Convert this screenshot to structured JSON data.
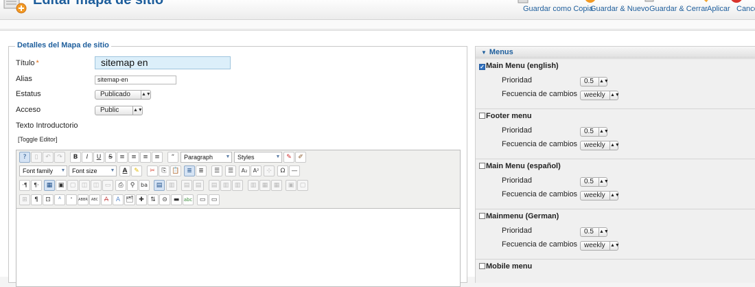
{
  "header": {
    "title": "Editar mapa de sitio",
    "toolbar": [
      {
        "label": "Guardar como Copia",
        "icon": "copy-icon",
        "color": "#dddddd"
      },
      {
        "label": "Guardar & Nuevo",
        "icon": "save-new-icon",
        "color": "#f39a24"
      },
      {
        "label": "Guardar & Cerrar",
        "icon": "save-close-icon",
        "color": "#d9d9d9"
      },
      {
        "label": "Aplicar",
        "icon": "apply-icon",
        "color": "#f0a431"
      },
      {
        "label": "Cance",
        "icon": "cancel-icon",
        "color": "#d9332b"
      }
    ]
  },
  "details": {
    "legend": "Detalles del Mapa de sitio",
    "titulo_label": "Título",
    "required_mark": "*",
    "titulo_value": "sitemap en",
    "alias_label": "Alias",
    "alias_value": "sitemap-en",
    "estatus_label": "Estatus",
    "estatus_value": "Publicado",
    "acceso_label": "Acceso",
    "acceso_value": "Public",
    "intro_label": "Texto Introductorio",
    "toggle_editor": "[Toggle Editor]"
  },
  "editor": {
    "format_select": "Paragraph",
    "styles_select": "Styles",
    "font_family_select": "Font family",
    "font_size_select": "Font size",
    "buttons": {
      "bold": "B",
      "italic": "I",
      "underline": "U",
      "strike": "S",
      "quote": "“",
      "omega": "Ω",
      "sub": "A₂",
      "sup": "A²",
      "ltr": "·¶",
      "rtl": "¶·",
      "para": "¶",
      "abbr_a": "A",
      "acronym": "ABBR",
      "abbr2": "ABC",
      "ins_a": "A",
      "ins_b": "A",
      "binoculars": "🔍",
      "spell": "abc",
      "find": "ba"
    }
  },
  "menus": {
    "header": "Menus",
    "priority_label": "Prioridad",
    "freq_label": "Fecuencia de cambios",
    "items": [
      {
        "name": "Main Menu (english)",
        "checked": true,
        "priority": "0.5",
        "frequency": "weekly"
      },
      {
        "name": "Footer menu",
        "checked": false,
        "priority": "0.5",
        "frequency": "weekly"
      },
      {
        "name": "Main Menu (español)",
        "checked": false,
        "priority": "0.5",
        "frequency": "weekly"
      },
      {
        "name": "Mainmenu (German)",
        "checked": false,
        "priority": "0.5",
        "frequency": "weekly"
      },
      {
        "name": "Mobile menu",
        "checked": false,
        "priority": "",
        "frequency": ""
      }
    ]
  }
}
